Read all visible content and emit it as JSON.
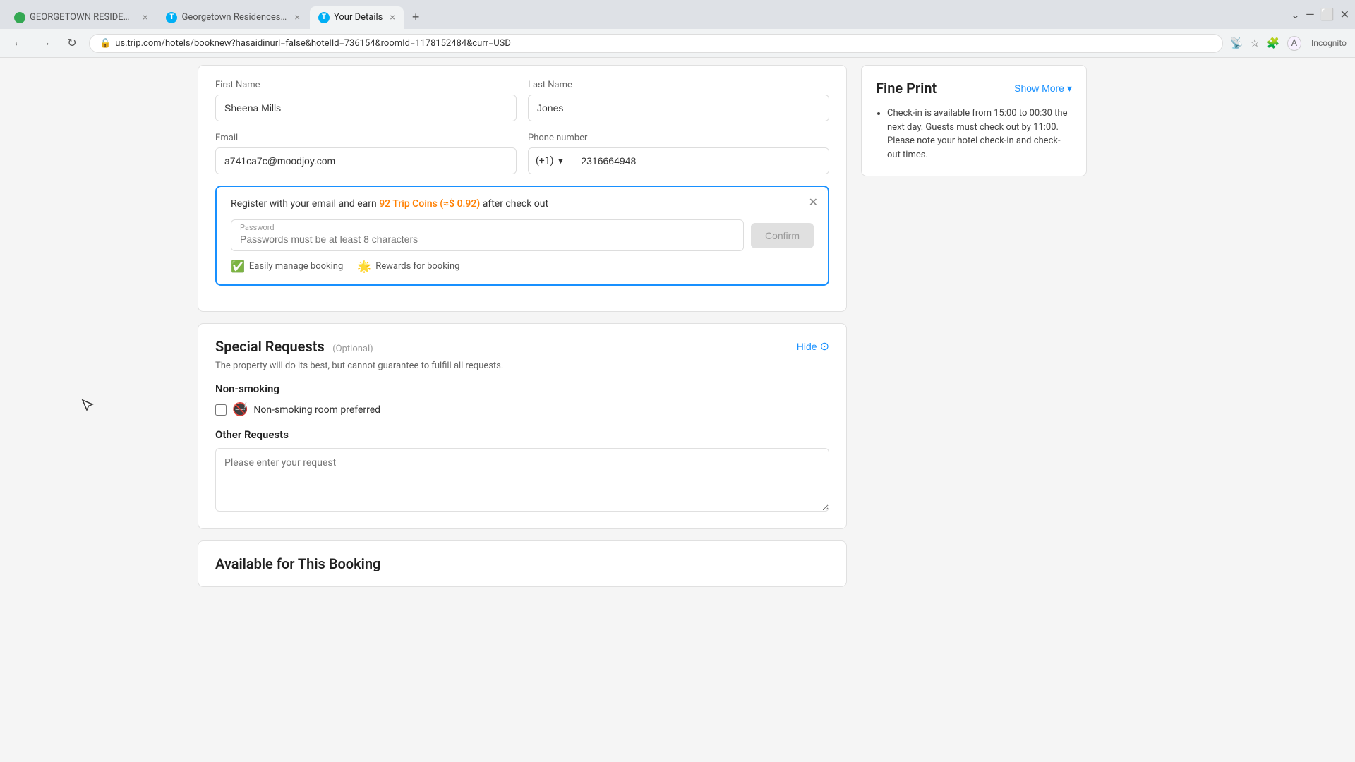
{
  "browser": {
    "tabs": [
      {
        "id": "tab1",
        "favicon_type": "green",
        "favicon_letter": "G",
        "label": "GEORGETOWN RESIDENCES BY",
        "active": false
      },
      {
        "id": "tab2",
        "favicon_type": "trip",
        "favicon_letter": "T",
        "label": "Georgetown Residences by Lux...",
        "active": false
      },
      {
        "id": "tab3",
        "favicon_type": "trip",
        "favicon_letter": "T",
        "label": "Your Details",
        "active": true
      }
    ],
    "url": "us.trip.com/hotels/booknew?hasaidinurl=false&hotelId=736154&roomId=1178152484&curr=USD",
    "incognito_label": "Incognito"
  },
  "form": {
    "first_name_label": "First Name",
    "first_name_value": "Sheena Mills",
    "last_name_label": "Last Name",
    "last_name_value": "Jones",
    "email_label": "Email",
    "email_value": "a741ca7c@moodjoy.com",
    "phone_label": "Phone number",
    "phone_country_code": "(+1)",
    "phone_number": "2316664948"
  },
  "registration_banner": {
    "text_before": "Register with your email and earn ",
    "trip_coins": "92 Trip Coins (≈$ 0.92)",
    "text_after": " after check out",
    "password_label": "Password",
    "password_placeholder": "Passwords must be at least 8 characters",
    "confirm_label": "Confirm",
    "benefit1_icon": "✅",
    "benefit1_text": "Easily manage booking",
    "benefit2_icon": "🌟",
    "benefit2_text": "Rewards for booking"
  },
  "special_requests": {
    "title": "Special Requests",
    "optional_badge": "(Optional)",
    "hide_label": "Hide",
    "property_note": "The property will do its best, but cannot guarantee to fulfill all requests.",
    "non_smoking_title": "Non-smoking",
    "non_smoking_option": "Non-smoking room preferred",
    "non_smoking_icon": "🚭",
    "other_requests_title": "Other Requests",
    "other_requests_placeholder": "Please enter your request"
  },
  "available_booking": {
    "title": "Available for This Booking"
  },
  "fine_print": {
    "title": "Fine Print",
    "show_more_label": "Show More",
    "items": [
      "Check-in is available from 15:00 to 00:30 the next day. Guests must check out by 11:00. Please note your hotel check-in and check-out times."
    ]
  }
}
